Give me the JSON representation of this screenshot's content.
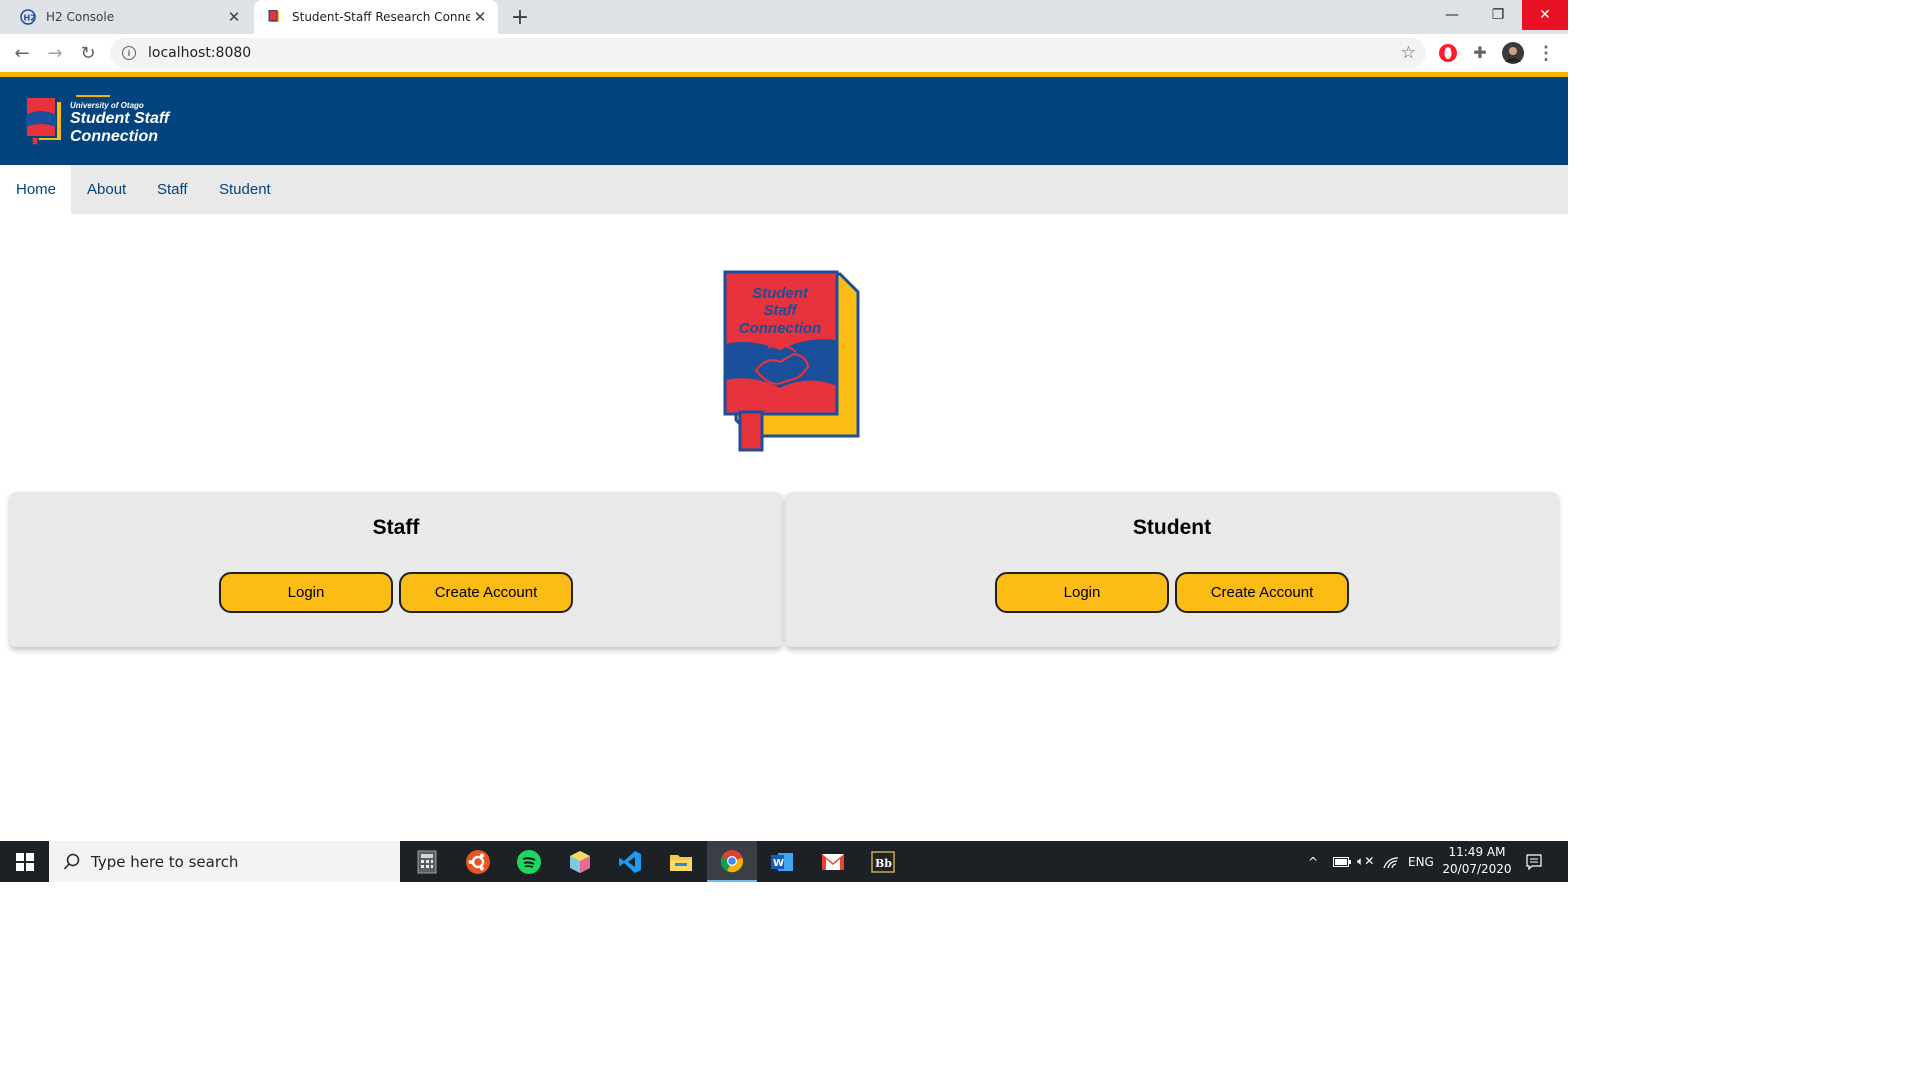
{
  "browser": {
    "tabs": [
      {
        "title": "H2 Console",
        "active": false
      },
      {
        "title": "Student-Staff Research Connectio",
        "active": true
      }
    ],
    "url": "localhost:8080"
  },
  "header": {
    "university": "University of Otago",
    "title_line1": "Student Staff",
    "title_line2": "Connection"
  },
  "nav": {
    "items": [
      "Home",
      "About",
      "Staff",
      "Student"
    ],
    "active": "Home"
  },
  "logo": {
    "line1": "Student",
    "line2": "Staff",
    "line3": "Connection"
  },
  "cards": [
    {
      "title": "Staff",
      "login_label": "Login",
      "create_label": "Create Account"
    },
    {
      "title": "Student",
      "login_label": "Login",
      "create_label": "Create Account"
    }
  ],
  "taskbar": {
    "search_placeholder": "Type here to search",
    "apps": [
      "calculator-icon",
      "ubuntu-icon",
      "spotify-icon",
      "box-app-icon",
      "vscode-icon",
      "file-explorer-icon",
      "chrome-icon",
      "word-icon",
      "gmail-icon",
      "blackboard-icon"
    ],
    "language": "ENG",
    "time": "11:49 AM",
    "date": "20/07/2020"
  },
  "colors": {
    "brand_blue": "#03437e",
    "accent_yellow": "#fbbc16",
    "logo_red": "#e8323c"
  }
}
